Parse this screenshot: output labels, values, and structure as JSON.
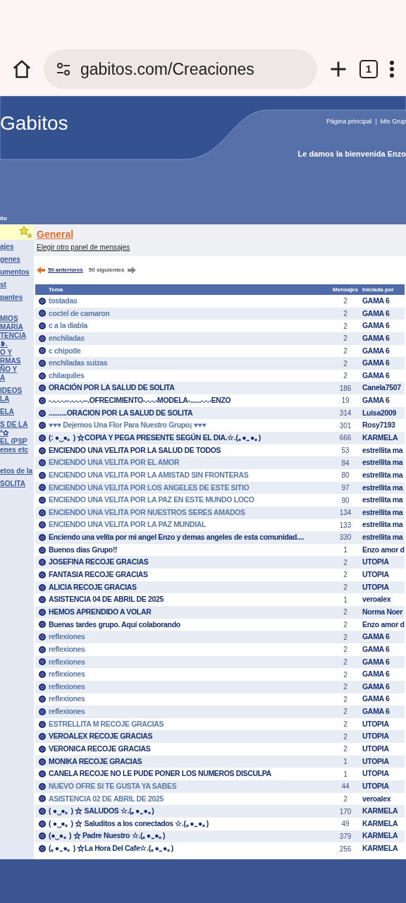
{
  "browser": {
    "url": "gabitos.com/Creaciones",
    "tab_count": "1"
  },
  "header": {
    "logo": "Gabitos",
    "links": "Página principal  |  Mis Grup",
    "welcome": "Le damos la bienvenida Enzo",
    "nav_label": "ito"
  },
  "sidebar": {
    "items": [
      [
        "ajes"
      ],
      [
        "genes"
      ],
      [
        "umentos"
      ],
      [
        "st"
      ],
      [
        "pantes"
      ],
      [
        "MIOS",
        "MARIA",
        "TENCIA",
        "❥.",
        "O Y",
        "RMAS",
        "ÑO Y",
        "A"
      ],
      [
        "IDEOS",
        "LA"
      ],
      [
        "ELA"
      ],
      [
        "S DE LA",
        "*✿",
        "EL (PSP",
        "enes etc"
      ],
      [
        "etos de la"
      ],
      [
        "SOLITA"
      ]
    ]
  },
  "board": {
    "title": "General",
    "change_link": "Elegir otro panel de mensajes",
    "prev": "50 anteriores",
    "next": "50 siguientes"
  },
  "table": {
    "columns": [
      "Tema",
      "Mensajes",
      "Iniciada por"
    ],
    "rows": [
      {
        "topic": "tostadas",
        "count": "2",
        "author": "GAMA 6",
        "visited": true
      },
      {
        "topic": "coctel de camaron",
        "count": "2",
        "author": "GAMA 6",
        "visited": true
      },
      {
        "topic": "c a la diabla",
        "count": "2",
        "author": "GAMA 6",
        "visited": true
      },
      {
        "topic": "enchiladas",
        "count": "2",
        "author": "GAMA 6",
        "visited": true
      },
      {
        "topic": "c chipotle",
        "count": "2",
        "author": "GAMA 6",
        "visited": true
      },
      {
        "topic": "enchiladas suizas",
        "count": "2",
        "author": "GAMA 6",
        "visited": true
      },
      {
        "topic": "chilaquiles",
        "count": "2",
        "author": "GAMA 6",
        "visited": true
      },
      {
        "topic": "ORACIÓN POR LA SALUD DE SOLITA",
        "count": "186",
        "author": "Canela7507",
        "visited": false
      },
      {
        "topic": "-.-.-.-.--.-.-.-.--.OFRECIMIENTO-.-.-.-MODELA-......-.-.-ENZO",
        "count": "19",
        "author": "GAMA 6",
        "visited": false
      },
      {
        "topic": "..........ORACION POR LA SALUD DE SOLITA",
        "count": "314",
        "author": "Luisa2009",
        "visited": false
      },
      {
        "topic": "♥♥♥ Dejemos Una Flor Para Nuestro Grupo¡ ♥♥♥",
        "count": "301",
        "author": "Rosy7193",
        "visited": true
      },
      {
        "topic": "(: ●‿●｡ ) ☆COPIA Y PEGA PRESENTE SEGÚN EL DIA.☆.(｡●‿●｡)",
        "count": "666",
        "author": "KARMELA",
        "visited": false
      },
      {
        "topic": "ENCIENDO UNA VELITA POR LA SALUD DE TODOS",
        "count": "53",
        "author": "estrellita ma",
        "visited": false
      },
      {
        "topic": "ENCIENDO UNA VELITA POR EL AMOR",
        "count": "84",
        "author": "estrellita ma",
        "visited": true
      },
      {
        "topic": "ENCIENDO UNA VELITA POR LA AMISTAD SIN FRONTERAS",
        "count": "80",
        "author": "estrellita ma",
        "visited": true
      },
      {
        "topic": "ENCIENDO UNA VELITA POR LOS ANGELES DE ESTE SITIO",
        "count": "97",
        "author": "estrellita ma",
        "visited": true
      },
      {
        "topic": "ENCIENDO UNA VELITA POR LA PAZ EN ESTE MUNDO LOCO",
        "count": "90",
        "author": "estrellita ma",
        "visited": true
      },
      {
        "topic": "ENCIENDO UNA VELITA POR NUESTROS SERES AMADOS",
        "count": "134",
        "author": "estrellita ma",
        "visited": true
      },
      {
        "topic": "ENCIENDO UNA VELITA POR LA PAZ MUNDIAL",
        "count": "133",
        "author": "estrellita ma",
        "visited": true
      },
      {
        "topic": "Enciendo una velita por mi angel Enzo y demas angeles de esta comunidad....",
        "count": "330",
        "author": "estrellita ma",
        "visited": false
      },
      {
        "topic": "Buenos días Grupo!!",
        "count": "1",
        "author": "Enzo amor d",
        "visited": false
      },
      {
        "topic": "JOSEFINA RECOJE GRACIAS",
        "count": "2",
        "author": "UTOPIA",
        "visited": false
      },
      {
        "topic": "FANTASIA RECOJE GRACIAS",
        "count": "2",
        "author": "UTOPIA",
        "visited": false
      },
      {
        "topic": "ALICIA RECOJE GRACIAS",
        "count": "2",
        "author": "UTOPIA",
        "visited": false
      },
      {
        "topic": "ASISTENCIA 04 DE ABRIL DE 2025",
        "count": "1",
        "author": "veroalex",
        "visited": false
      },
      {
        "topic": "HEMOS APRENDIDO A VOLAR",
        "count": "2",
        "author": "Norma Noer",
        "visited": false
      },
      {
        "topic": "Buenas tardes grupo. Aquí colaborando",
        "count": "2",
        "author": "Enzo amor d",
        "visited": false
      },
      {
        "topic": "reflexiones",
        "count": "2",
        "author": "GAMA 6",
        "visited": true
      },
      {
        "topic": "reflexiones",
        "count": "2",
        "author": "GAMA 6",
        "visited": true
      },
      {
        "topic": "reflexiones",
        "count": "2",
        "author": "GAMA 6",
        "visited": true
      },
      {
        "topic": "reflexiones",
        "count": "2",
        "author": "GAMA 6",
        "visited": true
      },
      {
        "topic": "reflexiones",
        "count": "2",
        "author": "GAMA 6",
        "visited": true
      },
      {
        "topic": "reflexiones",
        "count": "2",
        "author": "GAMA 6",
        "visited": true
      },
      {
        "topic": "reflexiones",
        "count": "2",
        "author": "GAMA 6",
        "visited": true
      },
      {
        "topic": "ESTRELLITA M RECOJE GRACIAS",
        "count": "2",
        "author": "UTOPIA",
        "visited": true
      },
      {
        "topic": "VEROALEX RECOJE GRACIAS",
        "count": "2",
        "author": "UTOPIA",
        "visited": false
      },
      {
        "topic": "VERONICA RECOJE GRACIAS",
        "count": "2",
        "author": "UTOPIA",
        "visited": false
      },
      {
        "topic": "MONIKA RECOJE GRACIAS",
        "count": "1",
        "author": "UTOPIA",
        "visited": false
      },
      {
        "topic": "CANELA RECOJE NO LE PUDE PONER LOS NUMEROS DISCULPA",
        "count": "1",
        "author": "UTOPIA",
        "visited": false
      },
      {
        "topic": "NUEVO OFRE SI TE GUSTA YA SABES",
        "count": "44",
        "author": "UTOPIA",
        "visited": true
      },
      {
        "topic": "ASISTENCIA 02 DE ABRIL DE 2025",
        "count": "2",
        "author": "veroalex",
        "visited": true
      },
      {
        "topic": "( ●‿●｡ ) ☆ SALUDOS ☆.(｡●‿●｡)",
        "count": "170",
        "author": "KARMELA",
        "visited": false
      },
      {
        "topic": "( ●‿●｡ ) ☆ Saluditos a los conectados ☆.(｡●‿●｡)",
        "count": "49",
        "author": "KARMELA",
        "visited": false
      },
      {
        "topic": "(●‿●｡ ) ☆ Padre Nuestro ☆.(｡●‿●｡)",
        "count": "379",
        "author": "KARMELA",
        "visited": false
      },
      {
        "topic": "(｡●‿●｡ ) ☆La Hora Del Cafe☆.(｡●‿●｡)",
        "count": "256",
        "author": "KARMELA",
        "visited": false
      }
    ]
  }
}
